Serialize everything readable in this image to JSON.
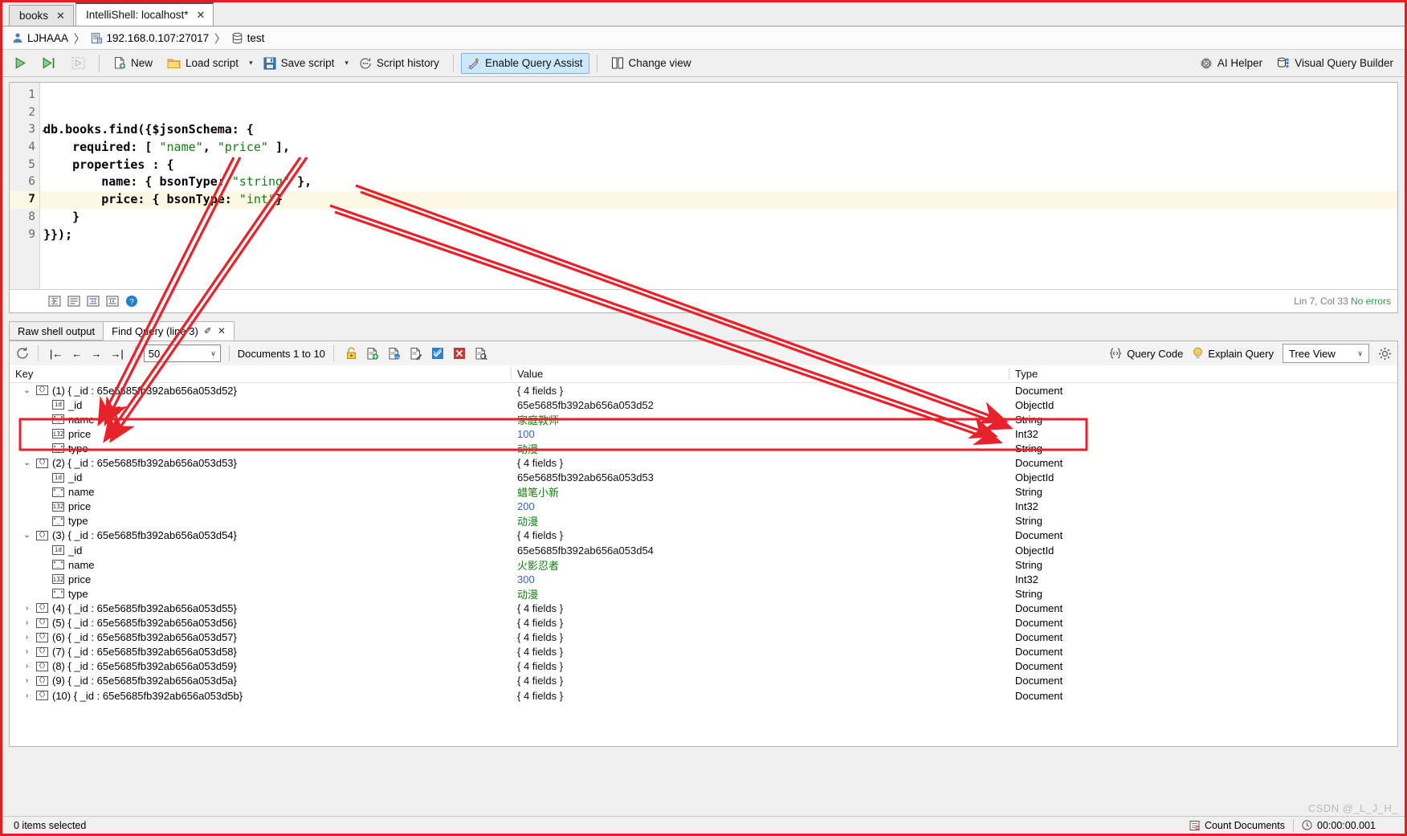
{
  "window": {
    "tabs": [
      {
        "label": "books",
        "active": false,
        "close": "✕"
      },
      {
        "label": "IntelliShell: localhost*",
        "active": true,
        "close": "✕"
      }
    ]
  },
  "breadcrumb": {
    "user": "LJHAAA",
    "sep1": "〉",
    "server": "192.168.0.107:27017",
    "sep2": "〉",
    "database": "test"
  },
  "toolbar": {
    "run_label": "",
    "run_line_label": "",
    "stop_label": "",
    "new_label": "New",
    "load_script_label": "Load script",
    "save_script_label": "Save script",
    "script_history_label": "Script history",
    "enable_query_assist_label": "Enable Query Assist",
    "change_view_label": "Change view",
    "ai_helper_label": "AI Helper",
    "visual_query_builder_label": "Visual Query Builder",
    "dropdown_caret": "▾",
    "highlight_color": "#cce8ff"
  },
  "editor": {
    "lines": [
      {
        "n": "1",
        "fold": "",
        "current": false,
        "tokens": []
      },
      {
        "n": "2",
        "fold": "",
        "current": false,
        "tokens": []
      },
      {
        "n": "3",
        "fold": "↙",
        "current": false,
        "tokens": [
          {
            "t": "db.books.find({$jsonSchema: {",
            "c": "kw"
          }
        ]
      },
      {
        "n": "4",
        "fold": "",
        "current": false,
        "tokens": [
          {
            "t": "    required: [ ",
            "c": "kw"
          },
          {
            "t": "\"name\"",
            "c": "str"
          },
          {
            "t": ", ",
            "c": "kw"
          },
          {
            "t": "\"price\"",
            "c": "str"
          },
          {
            "t": " ],",
            "c": "kw"
          }
        ]
      },
      {
        "n": "5",
        "fold": "",
        "current": false,
        "tokens": [
          {
            "t": "    properties : {",
            "c": "kw"
          }
        ]
      },
      {
        "n": "6",
        "fold": "",
        "current": false,
        "tokens": [
          {
            "t": "        name: { bsonType: ",
            "c": "kw"
          },
          {
            "t": "\"string\"",
            "c": "str"
          },
          {
            "t": " },",
            "c": "kw"
          }
        ]
      },
      {
        "n": "7",
        "fold": "",
        "current": true,
        "tokens": [
          {
            "t": "        price: { bsonType: ",
            "c": "kw"
          },
          {
            "t": "\"int\"",
            "c": "str"
          },
          {
            "t": "}",
            "c": "kw"
          }
        ]
      },
      {
        "n": "8",
        "fold": "",
        "current": false,
        "tokens": [
          {
            "t": "    }",
            "c": "kw"
          }
        ]
      },
      {
        "n": "9",
        "fold": "",
        "current": false,
        "tokens": [
          {
            "t": "}});",
            "c": "kw"
          }
        ]
      }
    ],
    "footbar_icons": [
      "format-script-icon",
      "align-lines-icon",
      "indent-right-icon",
      "indent-left-icon",
      "help-icon"
    ],
    "cursor_position": "Lin 7, Col 33",
    "error_status": "No errors"
  },
  "result_tabs": [
    {
      "label": "Raw shell output",
      "active": false
    },
    {
      "label": "Find Query (line 3)",
      "active": true,
      "pin": "✐",
      "close": "✕"
    }
  ],
  "results_toolbar": {
    "refresh_icon": "refresh-icon",
    "first_label": "|←",
    "prev_label": "←",
    "next_label": "→",
    "last_label": "→|",
    "page_size": "50",
    "documents_range": "Documents 1 to 10",
    "action_icons": [
      "lock-icon",
      "insert-document-icon",
      "clone-document-icon",
      "edit-document-icon",
      "commit-icon",
      "cancel-icon",
      "view-document-icon"
    ],
    "query_code_label": "Query Code",
    "explain_query_label": "Explain Query",
    "view_mode": "Tree View",
    "settings_icon": "gear-icon",
    "caret": "∨"
  },
  "grid": {
    "columns": [
      "Key",
      "Value",
      "Type"
    ],
    "rows": [
      {
        "level": 0,
        "twisty": "⌄",
        "badge": "〈〉",
        "badge_kind": "doc",
        "key": "(1) { _id : 65e5685fb392ab656a053d52}",
        "value": "{ 4 fields }",
        "value_color": "black",
        "type": "Document"
      },
      {
        "level": 1,
        "twisty": "",
        "badge": "id",
        "badge_kind": "id",
        "key": "_id",
        "value": "65e5685fb392ab656a053d52",
        "value_color": "black",
        "type": "ObjectId"
      },
      {
        "level": 1,
        "twisty": "",
        "badge": "\"_\"",
        "badge_kind": "str",
        "key": "name",
        "value": "家庭教师",
        "value_color": "green",
        "type": "String",
        "highlight": true
      },
      {
        "level": 1,
        "twisty": "",
        "badge": "i32",
        "badge_kind": "int",
        "key": "price",
        "value": "100",
        "value_color": "blue",
        "type": "Int32",
        "highlight": true
      },
      {
        "level": 1,
        "twisty": "",
        "badge": "\"_\"",
        "badge_kind": "str",
        "key": "type",
        "value": "动漫",
        "value_color": "green",
        "type": "String"
      },
      {
        "level": 0,
        "twisty": "⌄",
        "badge": "〈〉",
        "badge_kind": "doc",
        "key": "(2) { _id : 65e5685fb392ab656a053d53}",
        "value": "{ 4 fields }",
        "value_color": "black",
        "type": "Document"
      },
      {
        "level": 1,
        "twisty": "",
        "badge": "id",
        "badge_kind": "id",
        "key": "_id",
        "value": "65e5685fb392ab656a053d53",
        "value_color": "black",
        "type": "ObjectId"
      },
      {
        "level": 1,
        "twisty": "",
        "badge": "\"_\"",
        "badge_kind": "str",
        "key": "name",
        "value": "蜡笔小新",
        "value_color": "green",
        "type": "String"
      },
      {
        "level": 1,
        "twisty": "",
        "badge": "i32",
        "badge_kind": "int",
        "key": "price",
        "value": "200",
        "value_color": "blue",
        "type": "Int32"
      },
      {
        "level": 1,
        "twisty": "",
        "badge": "\"_\"",
        "badge_kind": "str",
        "key": "type",
        "value": "动漫",
        "value_color": "green",
        "type": "String"
      },
      {
        "level": 0,
        "twisty": "⌄",
        "badge": "〈〉",
        "badge_kind": "doc",
        "key": "(3) { _id : 65e5685fb392ab656a053d54}",
        "value": "{ 4 fields }",
        "value_color": "black",
        "type": "Document"
      },
      {
        "level": 1,
        "twisty": "",
        "badge": "id",
        "badge_kind": "id",
        "key": "_id",
        "value": "65e5685fb392ab656a053d54",
        "value_color": "black",
        "type": "ObjectId"
      },
      {
        "level": 1,
        "twisty": "",
        "badge": "\"_\"",
        "badge_kind": "str",
        "key": "name",
        "value": "火影忍者",
        "value_color": "green",
        "type": "String"
      },
      {
        "level": 1,
        "twisty": "",
        "badge": "i32",
        "badge_kind": "int",
        "key": "price",
        "value": "300",
        "value_color": "blue",
        "type": "Int32"
      },
      {
        "level": 1,
        "twisty": "",
        "badge": "\"_\"",
        "badge_kind": "str",
        "key": "type",
        "value": "动漫",
        "value_color": "green",
        "type": "String"
      },
      {
        "level": 0,
        "twisty": "›",
        "badge": "〈〉",
        "badge_kind": "doc",
        "key": "(4) { _id : 65e5685fb392ab656a053d55}",
        "value": "{ 4 fields }",
        "value_color": "black",
        "type": "Document"
      },
      {
        "level": 0,
        "twisty": "›",
        "badge": "〈〉",
        "badge_kind": "doc",
        "key": "(5) { _id : 65e5685fb392ab656a053d56}",
        "value": "{ 4 fields }",
        "value_color": "black",
        "type": "Document"
      },
      {
        "level": 0,
        "twisty": "›",
        "badge": "〈〉",
        "badge_kind": "doc",
        "key": "(6) { _id : 65e5685fb392ab656a053d57}",
        "value": "{ 4 fields }",
        "value_color": "black",
        "type": "Document"
      },
      {
        "level": 0,
        "twisty": "›",
        "badge": "〈〉",
        "badge_kind": "doc",
        "key": "(7) { _id : 65e5685fb392ab656a053d58}",
        "value": "{ 4 fields }",
        "value_color": "black",
        "type": "Document"
      },
      {
        "level": 0,
        "twisty": "›",
        "badge": "〈〉",
        "badge_kind": "doc",
        "key": "(8) { _id : 65e5685fb392ab656a053d59}",
        "value": "{ 4 fields }",
        "value_color": "black",
        "type": "Document"
      },
      {
        "level": 0,
        "twisty": "›",
        "badge": "〈〉",
        "badge_kind": "doc",
        "key": "(9) { _id : 65e5685fb392ab656a053d5a}",
        "value": "{ 4 fields }",
        "value_color": "black",
        "type": "Document"
      },
      {
        "level": 0,
        "twisty": "›",
        "badge": "〈〉",
        "badge_kind": "doc",
        "key": "(10) { _id : 65e5685fb392ab656a053d5b}",
        "value": "{ 4 fields }",
        "value_color": "black",
        "type": "Document"
      }
    ]
  },
  "status_bar": {
    "selection": "0 items selected",
    "count_documents": "Count Documents",
    "elapsed": "00:00:00.001"
  },
  "watermark": "CSDN @_L_J_H_",
  "annotation": {
    "color": "#e8222a",
    "note": "red arrows from code strings to result rows; red rectangles around name/price rows"
  }
}
